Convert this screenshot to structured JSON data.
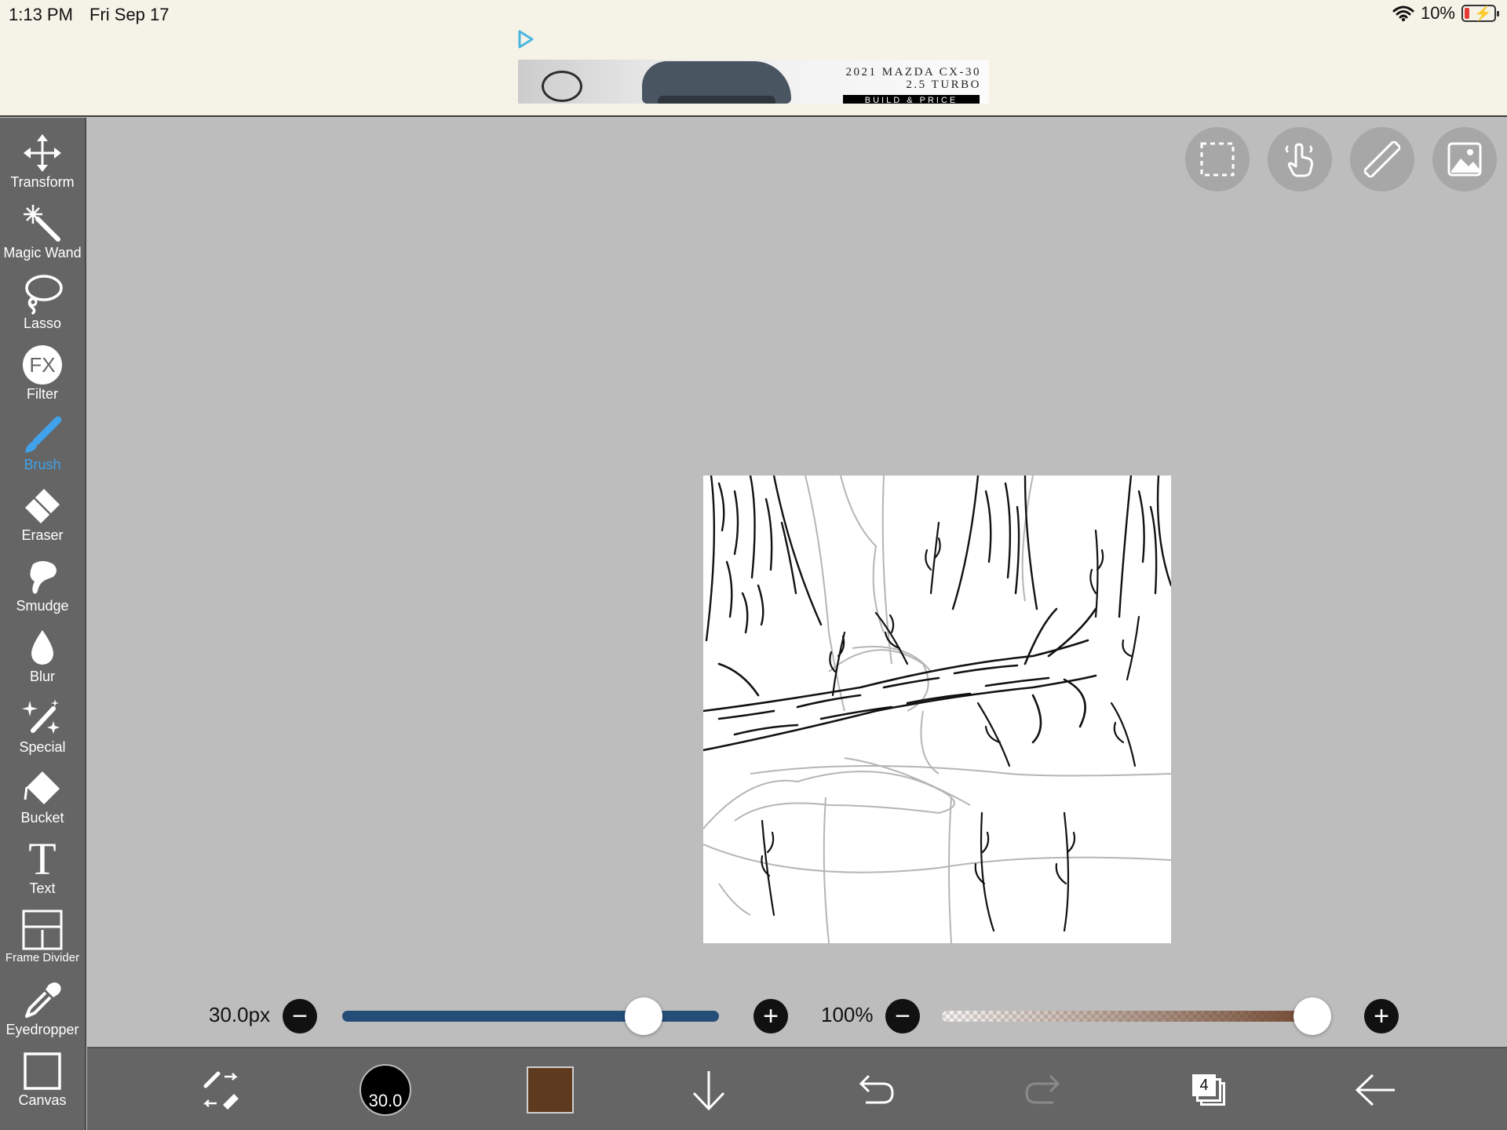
{
  "status_bar": {
    "time": "1:13 PM",
    "date": "Fri Sep 17",
    "battery": "10%"
  },
  "ad": {
    "title_line1": "2021 MAZDA CX-30",
    "title_line2": "2.5 TURBO",
    "cta": "BUILD & PRICE"
  },
  "tools": [
    {
      "label": "Transform",
      "icon": "transform-icon"
    },
    {
      "label": "Magic Wand",
      "icon": "magic-wand-icon"
    },
    {
      "label": "Lasso",
      "icon": "lasso-icon"
    },
    {
      "label": "Filter",
      "icon": "fx-icon",
      "icon_text": "FX"
    },
    {
      "label": "Brush",
      "icon": "brush-icon",
      "active": true
    },
    {
      "label": "Eraser",
      "icon": "eraser-icon"
    },
    {
      "label": "Smudge",
      "icon": "smudge-icon"
    },
    {
      "label": "Blur",
      "icon": "blur-drop-icon"
    },
    {
      "label": "Special",
      "icon": "special-icon"
    },
    {
      "label": "Bucket",
      "icon": "bucket-icon"
    },
    {
      "label": "Text",
      "icon": "text-icon",
      "icon_text": "T"
    },
    {
      "label": "Frame Divider",
      "icon": "frame-divider-icon"
    },
    {
      "label": "Eyedropper",
      "icon": "eyedropper-icon"
    },
    {
      "label": "Canvas",
      "icon": "canvas-icon"
    }
  ],
  "top_buttons": [
    "selection-icon",
    "gesture-hand-icon",
    "ruler-icon",
    "reference-image-icon"
  ],
  "brush_size": {
    "label": "30.0px",
    "value": 30.0,
    "fraction": 0.8
  },
  "opacity": {
    "label": "100%",
    "fraction": 1.0
  },
  "bottom_bar": {
    "brush_size_display": "30.0",
    "color": "#5e3a1f",
    "layers_count": "4"
  },
  "colors": {
    "active_tool": "#3fa2ea",
    "sidebar": "#656565",
    "workspace": "#bdbdbd",
    "size_track": "#244d78"
  }
}
